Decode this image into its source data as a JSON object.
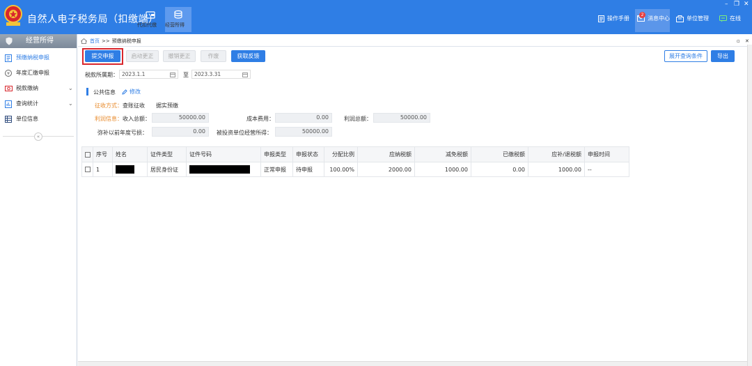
{
  "header": {
    "title": "自然人电子税务局（扣缴端）",
    "nav": [
      {
        "label": "代扣代缴",
        "icon": "wallet-icon"
      },
      {
        "label": "经营所得",
        "icon": "coins-icon"
      }
    ],
    "tools": {
      "manual": "操作手册",
      "messages": "消息中心",
      "message_count": "2",
      "unit": "单位管理",
      "online": "在线"
    }
  },
  "sidebar": {
    "title": "经营所得",
    "items": [
      {
        "label": "预缴纳税申报",
        "active": true
      },
      {
        "label": "年度汇缴申报",
        "active": false
      },
      {
        "label": "税款缴纳",
        "active": false
      },
      {
        "label": "查询统计",
        "active": false
      },
      {
        "label": "单位信息",
        "active": false
      }
    ],
    "collapse": "«"
  },
  "breadcrumb": {
    "home": "首页",
    "sep": ">>",
    "current": "预缴纳税申报"
  },
  "toolbar": {
    "submit": "提交申报",
    "start_correct": "启动更正",
    "cancel_correct": "撤销更正",
    "void": "作废",
    "get_feedback": "获取反馈",
    "expand_query": "展开查询条件",
    "export": "导出"
  },
  "period": {
    "label": "税款所属期：",
    "start": "2023.1.1",
    "to": "至",
    "end": "2023.3.31"
  },
  "public_info": {
    "title": "公共信息",
    "edit": "修改",
    "collect_label": "征收方式：",
    "collect_value": "查账征收",
    "collect_detail": "据实预缴",
    "profit_label": "利润信息：",
    "income_label": "收入总额：",
    "income_value": "50000.00",
    "cost_label": "成本费用：",
    "cost_value": "0.00",
    "profit_total_label": "利润总额：",
    "profit_total_value": "50000.00",
    "loss_label": "弥补以前年度亏损：",
    "loss_value": "0.00",
    "invested_label": "被投资单位经营所得：",
    "invested_value": "50000.00"
  },
  "table": {
    "headers": [
      "序号",
      "姓名",
      "证件类型",
      "证件号码",
      "申报类型",
      "申报状态",
      "分配比例",
      "应纳税额",
      "减免税额",
      "已缴税额",
      "应补/退税额",
      "申报时间"
    ],
    "rows": [
      {
        "index": "1",
        "id_type": "居民身份证",
        "report_type": "正常申报",
        "status": "待申报",
        "ratio": "100.00%",
        "tax_payable": "2000.00",
        "tax_relief": "1000.00",
        "tax_paid": "0.00",
        "tax_due": "1000.00",
        "time": "--"
      }
    ]
  },
  "colors": {
    "primary": "#2f7ee5",
    "highlight_frame": "#d8262c",
    "orange_label": "#e88a2a"
  }
}
